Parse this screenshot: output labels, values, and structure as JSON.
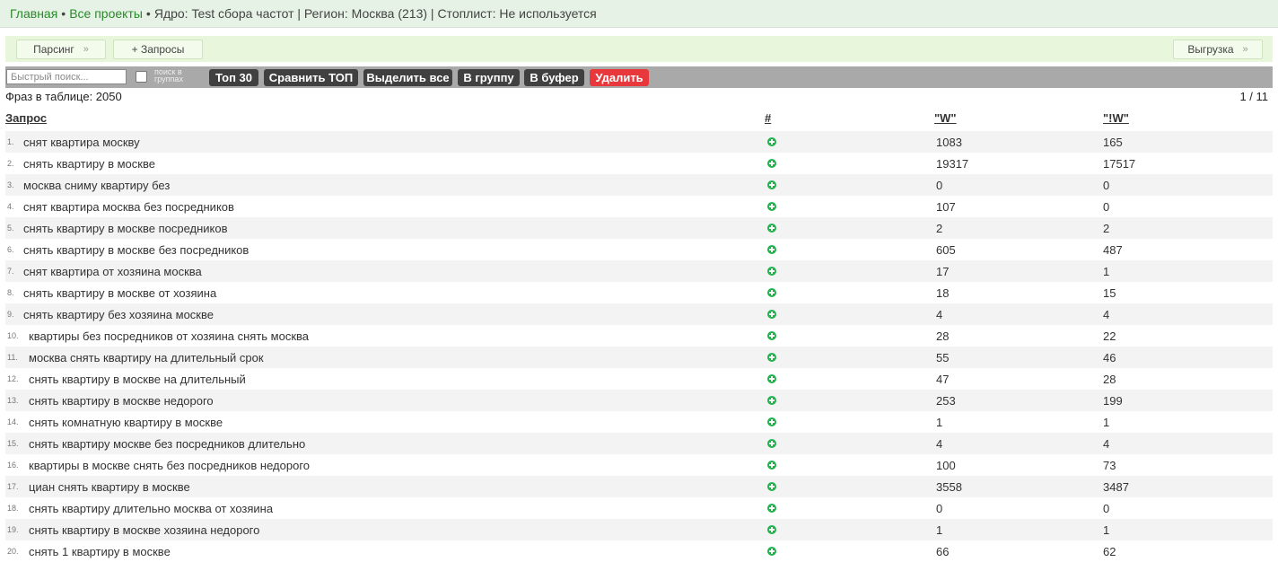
{
  "breadcrumb": {
    "home": "Главная",
    "bullet1": "•",
    "projects": "Все проекты",
    "bullet2": "•",
    "core": "Ядро: Test сбора частот | Регион: Москва (213) | Стоплист: Не используется"
  },
  "toolbar": {
    "parsing": "Парсинг",
    "parsing_chevron": "»",
    "queries": "+ Запросы",
    "export": "Выгрузка",
    "export_chevron": "»"
  },
  "filter": {
    "search_placeholder": "Быстрый поиск...",
    "group_search_label": "поиск в группах",
    "top30": "Топ 30",
    "compare_top": "Сравнить ТОП",
    "select_all": "Выделить все",
    "to_group": "В группу",
    "to_buffer": "В буфер",
    "delete": "Удалить",
    "delete_color": "#e8383b"
  },
  "table": {
    "count_label": "Фраз в таблице: 2050",
    "pager": "1 / 11",
    "headers": {
      "query": "Запрос",
      "hash": "#",
      "w": "\"W\"",
      "ew": "\"!W\""
    },
    "add_icon": "plus-circle-icon",
    "rows": [
      {
        "n": "1.",
        "q": "снят квартира москву",
        "w": "1083",
        "ew": "165"
      },
      {
        "n": "2.",
        "q": "снять квартиру в москве",
        "w": "19317",
        "ew": "17517"
      },
      {
        "n": "3.",
        "q": "москва сниму квартиру без",
        "w": "0",
        "ew": "0"
      },
      {
        "n": "4.",
        "q": "снят квартира москва без посредников",
        "w": "107",
        "ew": "0"
      },
      {
        "n": "5.",
        "q": "снять квартиру в москве посредников",
        "w": "2",
        "ew": "2"
      },
      {
        "n": "6.",
        "q": "снять квартиру в москве без посредников",
        "w": "605",
        "ew": "487"
      },
      {
        "n": "7.",
        "q": "снят квартира от хозяина москва",
        "w": "17",
        "ew": "1"
      },
      {
        "n": "8.",
        "q": "снять квартиру в москве от хозяина",
        "w": "18",
        "ew": "15"
      },
      {
        "n": "9.",
        "q": "снять квартиру без хозяина москве",
        "w": "4",
        "ew": "4"
      },
      {
        "n": "10.",
        "q": "квартиры без посредников от хозяина снять москва",
        "w": "28",
        "ew": "22"
      },
      {
        "n": "11.",
        "q": "москва снять квартиру на длительный срок",
        "w": "55",
        "ew": "46"
      },
      {
        "n": "12.",
        "q": "снять квартиру в москве на длительный",
        "w": "47",
        "ew": "28"
      },
      {
        "n": "13.",
        "q": "снять квартиру в москве недорого",
        "w": "253",
        "ew": "199"
      },
      {
        "n": "14.",
        "q": "снять комнатную квартиру в москве",
        "w": "1",
        "ew": "1"
      },
      {
        "n": "15.",
        "q": "снять квартиру москве без посредников длительно",
        "w": "4",
        "ew": "4"
      },
      {
        "n": "16.",
        "q": "квартиры в москве снять без посредников недорого",
        "w": "100",
        "ew": "73"
      },
      {
        "n": "17.",
        "q": "циан снять квартиру в москве",
        "w": "3558",
        "ew": "3487"
      },
      {
        "n": "18.",
        "q": "снять квартиру длительно москва от хозяина",
        "w": "0",
        "ew": "0"
      },
      {
        "n": "19.",
        "q": "снять квартиру в москве хозяина недорого",
        "w": "1",
        "ew": "1"
      },
      {
        "n": "20.",
        "q": "снять 1 квартиру в москве",
        "w": "66",
        "ew": "62"
      }
    ]
  }
}
